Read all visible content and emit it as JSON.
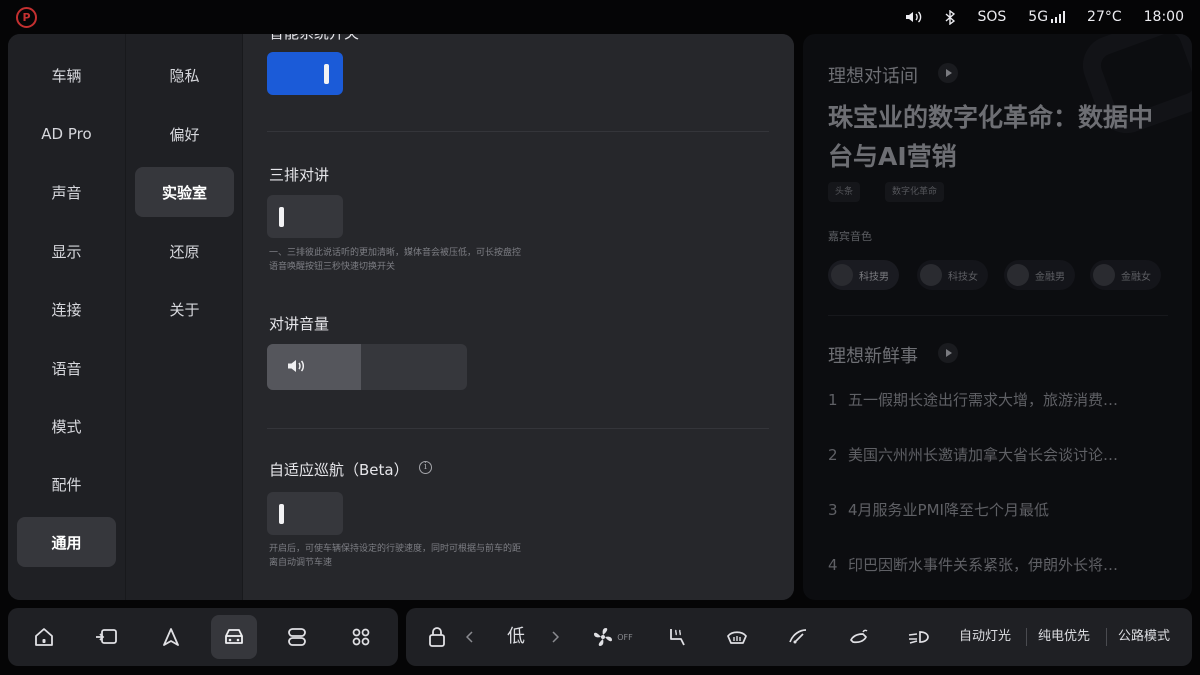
{
  "status_bar": {
    "sos": "SOS",
    "network": "5G",
    "temperature": "27°C",
    "time": "18:00",
    "icons": [
      "parking-brake-icon",
      "volume-icon",
      "bluetooth-icon",
      "signal-icon"
    ]
  },
  "nav_primary": [
    "车辆",
    "AD Pro",
    "声音",
    "显示",
    "连接",
    "语音",
    "模式",
    "配件",
    "通用"
  ],
  "nav_primary_active": "通用",
  "nav_secondary": [
    "隐私",
    "偏好",
    "实验室",
    "还原",
    "关于"
  ],
  "nav_secondary_active": "实验室",
  "content": {
    "top_partial_label": "智能系统开关",
    "top_toggle_state": "on",
    "intercom_label": "三排对讲",
    "intercom_state": "off",
    "intercom_hint": "一、三排彼此说话听的更加清晰，媒体音会被压低，可长按盘控语音唤醒按钮三秒快速切换开关",
    "volume_label": "对讲音量",
    "volume_level": 0.47,
    "acc_label": "自适应巡航（Beta）",
    "acc_info": "i",
    "acc_state": "off",
    "acc_hint": "开启后，可使车辆保持设定的行驶速度，同时可根据与前车的距离自动调节车速"
  },
  "right_panel": {
    "section1_title": "理想对话间",
    "headline": "珠宝业的数字化革命：数据中台与AI营销",
    "tags": [
      "头条",
      "数字化革命"
    ],
    "voice_label": "嘉宾音色",
    "voices": [
      "科技男",
      "科技女",
      "金融男",
      "金融女"
    ],
    "section2_title": "理想新鲜事",
    "news": [
      {
        "num": "1",
        "text": "五一假期长途出行需求大增，旅游消费…"
      },
      {
        "num": "2",
        "text": "美国六州州长邀请加拿大省长会谈讨论…"
      },
      {
        "num": "3",
        "text": "4月服务业PMI降至七个月最低"
      },
      {
        "num": "4",
        "text": "印巴因断水事件关系紧张，伊朗外长将…"
      }
    ]
  },
  "dock_left": {
    "icons": [
      "home-icon",
      "passenger-screen-icon",
      "navigation-icon",
      "car-icon",
      "app-switch-icon",
      "apps-grid-icon"
    ],
    "selected": "car-icon"
  },
  "dock_right": {
    "fan_level": "低",
    "fan_state": "OFF",
    "icons": [
      "lock-icon",
      "fan-icon",
      "seat-heat-icon",
      "defrost-icon",
      "wiper-icon",
      "mirror-icon",
      "headlight-icon"
    ],
    "auto_light": "自动灯光",
    "ev_priority": "纯电优先",
    "road_mode": "公路模式"
  },
  "colors": {
    "accent_blue": "#1b5bd8",
    "parking_red": "#c43030",
    "panel": "#1f2024",
    "content_bg": "#26272b"
  }
}
